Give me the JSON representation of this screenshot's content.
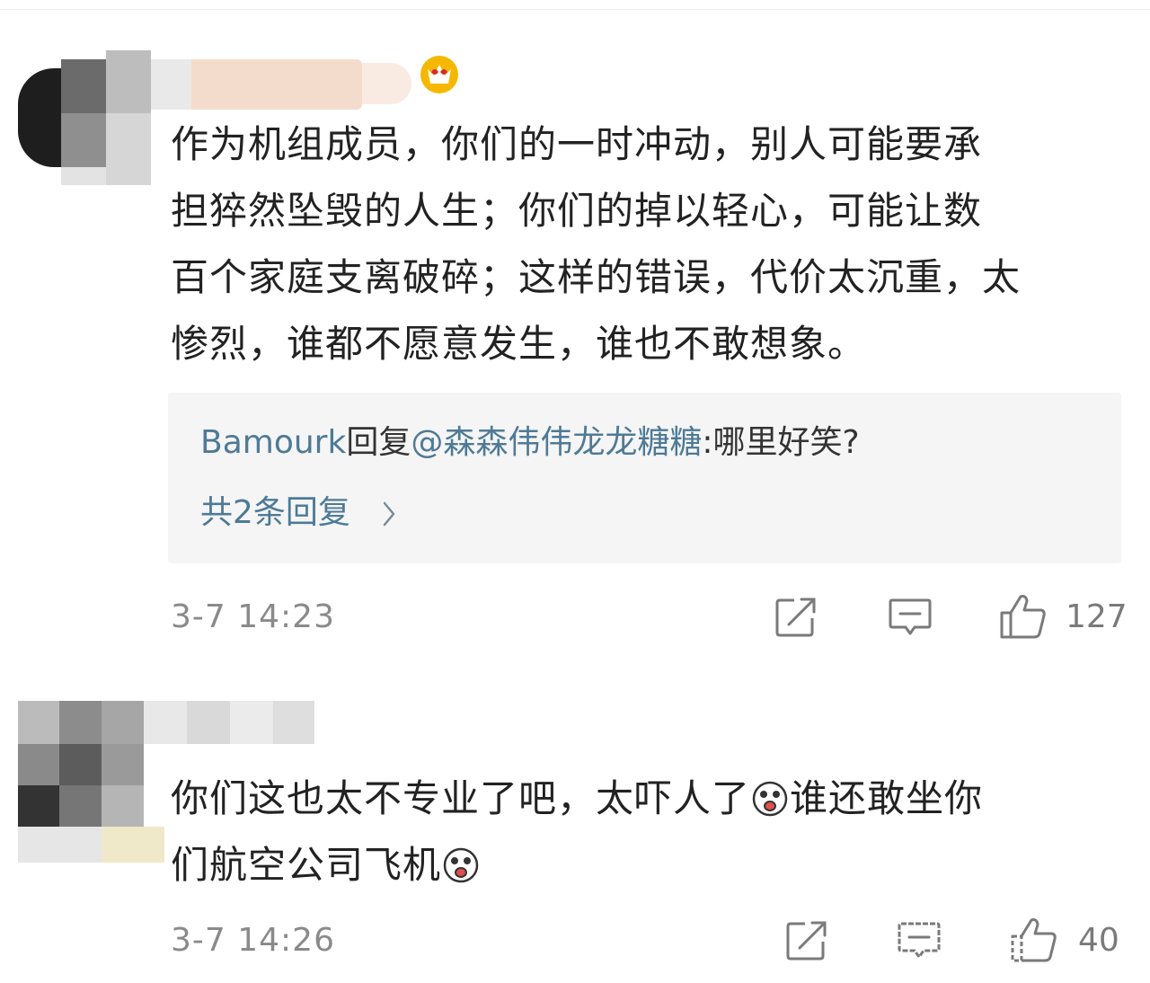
{
  "comments": [
    {
      "text": "作为机组成员，你们的一时冲动，别人可能要承担猝然坠毁的人生；你们的掉以轻心，可能让数百个家庭支离破碎；这样的错误，代价太沉重，太惨烈，谁都不愿意发生，谁也不敢想象。",
      "lines": [
        "作为机组成员，你们的一时冲动，别人可能要承",
        "担猝然坠毁的人生；你们的掉以轻心，可能让数",
        "百个家庭支离破碎；这样的错误，代价太沉重，太",
        "惨烈，谁都不愿意发生，谁也不敢想象。"
      ],
      "reply": {
        "author": "Bamourk",
        "reply_word": "回复",
        "at_target": "@森森伟伟龙龙糖糖",
        "colon": ":",
        "content": "哪里好笑?",
        "more_label": "共2条回复",
        "more_icon": "chevron-right-icon"
      },
      "time": "3-7 14:23",
      "likes": "127",
      "icons": [
        "share-icon",
        "comment-icon",
        "thumbs-up-icon"
      ]
    },
    {
      "line1_a": "你们这也太不专业了吧，太吓人了",
      "line1_b": "谁还敢坐你",
      "line2": "们航空公司飞机",
      "emoji": "shocked-face-emoji",
      "time": "3-7 14:26",
      "likes": "40",
      "icons": [
        "share-icon",
        "comment-icon",
        "thumbs-up-icon"
      ]
    }
  ],
  "colors": {
    "link": "#4e7a96",
    "text": "#222222",
    "meta": "#8a8a8a",
    "reply_bg": "#f5f5f5",
    "vip_badge": "#f5b800"
  }
}
